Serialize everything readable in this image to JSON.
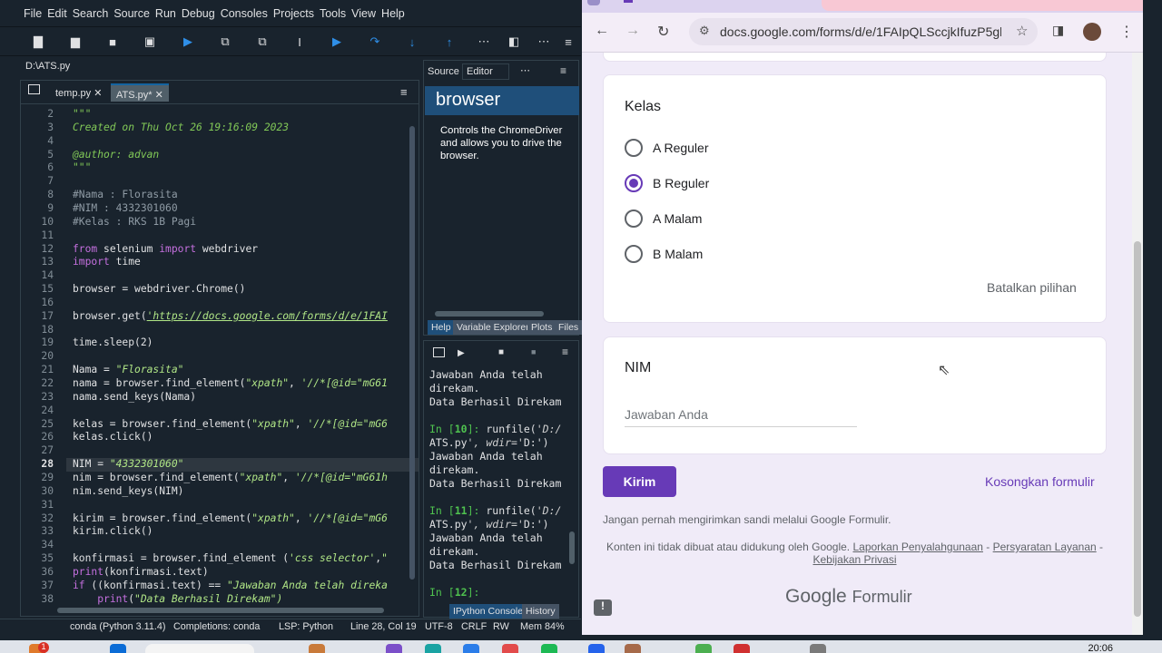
{
  "spyder": {
    "menu": [
      "File",
      "Edit",
      "Search",
      "Source",
      "Run",
      "Debug",
      "Consoles",
      "Projects",
      "Tools",
      "View",
      "Help"
    ],
    "path": "D:\\ATS.py",
    "tabs": [
      "temp.py",
      "ATS.py*"
    ],
    "code_lines": [
      {
        "n": "2",
        "t": "\"\"\"",
        "cls": "c-doc"
      },
      {
        "n": "3",
        "t": "Created on Thu Oct 26 19:16:09 2023",
        "cls": "c-doc"
      },
      {
        "n": "4",
        "t": "",
        "cls": ""
      },
      {
        "n": "5",
        "t": "@author: advan",
        "cls": "c-doc"
      },
      {
        "n": "6",
        "t": "\"\"\"",
        "cls": "c-doc"
      },
      {
        "n": "7",
        "t": "",
        "cls": ""
      },
      {
        "n": "8",
        "t": "#Nama : Florasita",
        "cls": "c-cm"
      },
      {
        "n": "9",
        "t": "#NIM : 4332301060",
        "cls": "c-cm"
      },
      {
        "n": "10",
        "t": "#Kelas : RKS 1B Pagi",
        "cls": "c-cm"
      },
      {
        "n": "11",
        "t": "",
        "cls": ""
      },
      {
        "n": "12",
        "t": "from selenium import webdriver",
        "cls": "imp1"
      },
      {
        "n": "13",
        "t": "import time",
        "cls": "imp2"
      },
      {
        "n": "14",
        "t": "",
        "cls": ""
      },
      {
        "n": "15",
        "t": "browser = webdriver.Chrome()",
        "cls": ""
      },
      {
        "n": "16",
        "t": "",
        "cls": ""
      },
      {
        "n": "17",
        "t": "browser.get('https://docs.google.com/forms/d/e/1FAI",
        "cls": "url"
      },
      {
        "n": "18",
        "t": "",
        "cls": ""
      },
      {
        "n": "19",
        "t": "time.sleep(2)",
        "cls": ""
      },
      {
        "n": "20",
        "t": "",
        "cls": ""
      },
      {
        "n": "21",
        "t": "Nama = \"Florasita\"",
        "cls": "assign"
      },
      {
        "n": "22",
        "t": "nama = browser.find_element(\"xpath\", '//*[@id=\"mG61",
        "cls": "find"
      },
      {
        "n": "23",
        "t": "nama.send_keys(Nama)",
        "cls": ""
      },
      {
        "n": "24",
        "t": "",
        "cls": ""
      },
      {
        "n": "25",
        "t": "kelas = browser.find_element(\"xpath\", '//*[@id=\"mG6",
        "cls": "find"
      },
      {
        "n": "26",
        "t": "kelas.click()",
        "cls": ""
      },
      {
        "n": "27",
        "t": "",
        "cls": ""
      },
      {
        "n": "28",
        "t": "NIM = \"4332301060\"",
        "cls": "assign"
      },
      {
        "n": "29",
        "t": "nim = browser.find_element(\"xpath\", '//*[@id=\"mG61h",
        "cls": "find"
      },
      {
        "n": "30",
        "t": "nim.send_keys(NIM)",
        "cls": ""
      },
      {
        "n": "31",
        "t": "",
        "cls": ""
      },
      {
        "n": "32",
        "t": "kirim = browser.find_element(\"xpath\", '//*[@id=\"mG6",
        "cls": "find"
      },
      {
        "n": "33",
        "t": "kirim.click()",
        "cls": ""
      },
      {
        "n": "34",
        "t": "",
        "cls": ""
      },
      {
        "n": "35",
        "t": "konfirmasi = browser.find_element ('css selector',\"",
        "cls": "find"
      },
      {
        "n": "36",
        "t": "print(konfirmasi.text)",
        "cls": ""
      },
      {
        "n": "37",
        "t": "if ((konfirmasi.text) == \"Jawaban Anda telah direka",
        "cls": "if"
      },
      {
        "n": "38",
        "t": "    print(\"Data Berhasil Direkam\")",
        "cls": "print"
      }
    ],
    "current_line": "28",
    "help": {
      "source_label": "Source",
      "editor_label": "Editor",
      "title": "browser",
      "description": "Controls the ChromeDriver and allows you to drive the browser.",
      "tabs": [
        "Help",
        "Variable Explorer",
        "Plots",
        "Files"
      ]
    },
    "console": {
      "lines": [
        {
          "k": "out",
          "t": "Jawaban Anda telah"
        },
        {
          "k": "out",
          "t": "direkam."
        },
        {
          "k": "out",
          "t": "Data Berhasil Direkam"
        },
        {
          "k": "out",
          "t": ""
        },
        {
          "k": "in",
          "t": "In [10]: runfile('D:/"
        },
        {
          "k": "cont",
          "t": "ATS.py', wdir='D:')"
        },
        {
          "k": "out",
          "t": "Jawaban Anda telah"
        },
        {
          "k": "out",
          "t": "direkam."
        },
        {
          "k": "out",
          "t": "Data Berhasil Direkam"
        },
        {
          "k": "out",
          "t": ""
        },
        {
          "k": "in",
          "t": "In [11]: runfile('D:/"
        },
        {
          "k": "cont",
          "t": "ATS.py', wdir='D:')"
        },
        {
          "k": "out",
          "t": "Jawaban Anda telah"
        },
        {
          "k": "out",
          "t": "direkam."
        },
        {
          "k": "out",
          "t": "Data Berhasil Direkam"
        },
        {
          "k": "out",
          "t": ""
        },
        {
          "k": "in",
          "t": "In [12]:"
        }
      ],
      "tabs": [
        "IPython Console",
        "History"
      ]
    },
    "status": {
      "env": "conda (Python 3.11.4)",
      "completions": "Completions: conda",
      "lsp": "LSP: Python",
      "position": "Line 28, Col 19",
      "encoding": "UTF-8",
      "eol": "CRLF",
      "rw": "RW",
      "mem": "Mem 84%"
    }
  },
  "chrome": {
    "url": "docs.google.com/forms/d/e/1FAIpQLSccjkIfuzP5gl...",
    "form": {
      "kelas_title": "Kelas",
      "options": [
        {
          "label": "A Reguler",
          "selected": false
        },
        {
          "label": "B Reguler",
          "selected": true
        },
        {
          "label": "A Malam",
          "selected": false
        },
        {
          "label": "B Malam",
          "selected": false
        }
      ],
      "clear_choice": "Batalkan pilihan",
      "nim_title": "NIM",
      "nim_placeholder": "Jawaban Anda",
      "submit": "Kirim",
      "clear_form": "Kosongkan formulir",
      "warning": "Jangan pernah mengirimkan sandi melalui Google Formulir.",
      "footer_text": "Konten ini tidak dibuat atau didukung oleh Google.",
      "footer_link1": "Laporkan Penyalahgunaan",
      "footer_sep1": " - ",
      "footer_link2": "Persyaratan Layanan",
      "footer_sep2": " - ",
      "footer_link3": "Kebijakan Privasi",
      "logo_google": "Google",
      "logo_formulir": "Formulir"
    },
    "accent": "#673ab7"
  },
  "taskbar": {
    "time": "20:06",
    "badge": "1"
  }
}
